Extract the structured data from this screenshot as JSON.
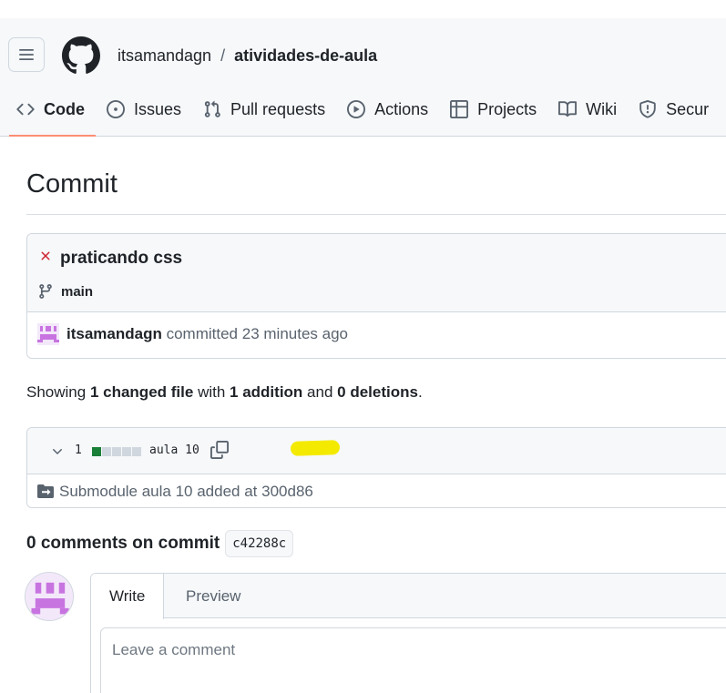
{
  "header": {
    "owner": "itsamandagn",
    "separator": "/",
    "repo": "atividades-de-aula"
  },
  "nav": {
    "tabs": [
      {
        "label": "Code",
        "icon": "code-icon",
        "active": true
      },
      {
        "label": "Issues",
        "icon": "issue-opened-icon"
      },
      {
        "label": "Pull requests",
        "icon": "git-pull-request-icon"
      },
      {
        "label": "Actions",
        "icon": "play-icon"
      },
      {
        "label": "Projects",
        "icon": "table-icon"
      },
      {
        "label": "Wiki",
        "icon": "book-icon"
      },
      {
        "label": "Secur",
        "icon": "shield-icon"
      }
    ]
  },
  "page": {
    "title": "Commit"
  },
  "commit": {
    "status_icon": "x-icon",
    "message": "praticando css",
    "branch": "main",
    "author": "itsamandagn",
    "action": "committed",
    "time": "23 minutes ago"
  },
  "summary": {
    "prefix": "Showing",
    "changed_files": "1 changed file",
    "with": "with",
    "additions": "1 addition",
    "and": "and",
    "deletions": "0 deletions",
    "suffix": "."
  },
  "file": {
    "count": "1",
    "name": "aula 10",
    "diffstat": [
      "added",
      "neutral",
      "neutral",
      "neutral",
      "neutral"
    ],
    "body": "Submodule aula 10 added at 300d86"
  },
  "comments": {
    "title": "0 comments on commit",
    "sha": "c42288c"
  },
  "editor": {
    "tab_write": "Write",
    "tab_preview": "Preview",
    "placeholder": "Leave a comment"
  },
  "colors": {
    "accent_underline": "#fd8c73",
    "error_red": "#cf222e",
    "diff_added": "#1a7f37",
    "diff_neutral": "#d0d7de",
    "highlight": "#f4ea00",
    "avatar": "#c874e0"
  }
}
